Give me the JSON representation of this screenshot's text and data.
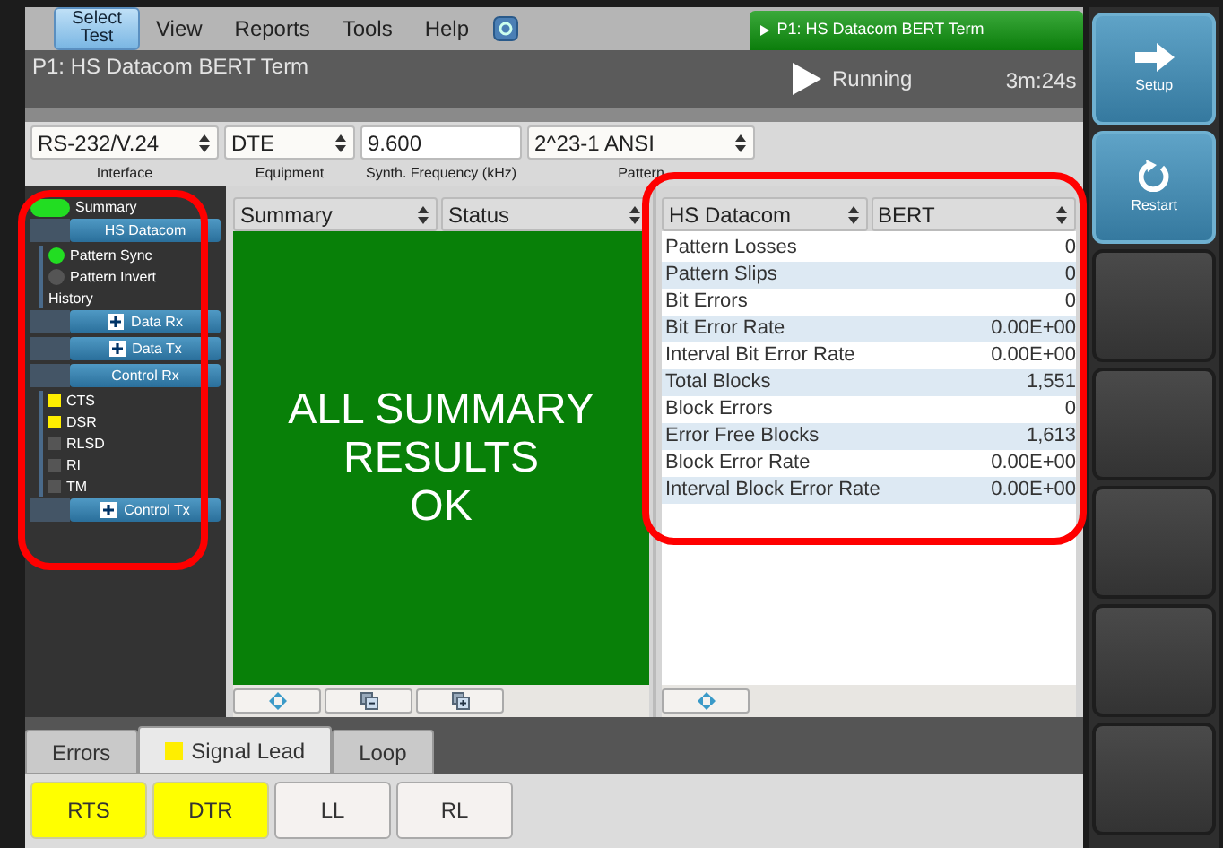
{
  "menu": {
    "select_test": "Select\nTest",
    "items": [
      "View",
      "Reports",
      "Tools",
      "Help"
    ]
  },
  "port_tab": {
    "label": "P1: HS Datacom BERT Term",
    "selected": true
  },
  "title": "P1: HS Datacom BERT Term",
  "status": "Running",
  "elapsed": "3m:24s",
  "config": [
    {
      "kind": "select",
      "value": "RS-232/V.24",
      "label": "Interface"
    },
    {
      "kind": "select",
      "value": "DTE",
      "label": "Equipment"
    },
    {
      "kind": "input",
      "value": "9.600",
      "label": "Synth. Frequency (kHz)"
    },
    {
      "kind": "select",
      "value": "2^23-1 ANSI",
      "label": "Pattern"
    }
  ],
  "sidebar": {
    "highlighted": true,
    "items": [
      {
        "kind": "pill",
        "label": "Summary",
        "color": "#22dd22"
      },
      {
        "kind": "section",
        "label": "HS Datacom",
        "expandable": false,
        "children": [
          {
            "kind": "led",
            "label": "Pattern Sync",
            "color": "#22dd22"
          },
          {
            "kind": "led",
            "label": "Pattern Invert",
            "color": "#555555"
          },
          {
            "kind": "text",
            "label": "History"
          }
        ]
      },
      {
        "kind": "section",
        "label": "Data Rx",
        "expandable": true
      },
      {
        "kind": "section",
        "label": "Data Tx",
        "expandable": true
      },
      {
        "kind": "section",
        "label": "Control Rx",
        "expandable": false,
        "children": [
          {
            "kind": "square",
            "label": "CTS",
            "color": "#ffee00"
          },
          {
            "kind": "square",
            "label": "DSR",
            "color": "#ffee00"
          },
          {
            "kind": "square",
            "label": "RLSD",
            "color": "#555555"
          },
          {
            "kind": "square",
            "label": "RI",
            "color": "#555555"
          },
          {
            "kind": "square",
            "label": "TM",
            "color": "#555555"
          }
        ]
      },
      {
        "kind": "section",
        "label": "Control Tx",
        "expandable": true
      }
    ]
  },
  "summary_panel": {
    "selects": [
      "Summary",
      "Status"
    ],
    "message": [
      "ALL SUMMARY",
      "RESULTS",
      "OK"
    ],
    "tools": [
      {
        "kind": "move"
      },
      {
        "kind": "collapse"
      },
      {
        "kind": "expand"
      }
    ]
  },
  "results_panel": {
    "highlighted": true,
    "selects": [
      "HS Datacom",
      "BERT"
    ],
    "rows": [
      {
        "label": "Pattern Losses",
        "value": "0"
      },
      {
        "label": "Pattern Slips",
        "value": "0"
      },
      {
        "label": "Bit Errors",
        "value": "0"
      },
      {
        "label": "Bit Error Rate",
        "value": "0.00E+00"
      },
      {
        "label": "Interval Bit Error Rate",
        "value": "0.00E+00"
      },
      {
        "label": "Total Blocks",
        "value": "1,551"
      },
      {
        "label": "Block Errors",
        "value": "0"
      },
      {
        "label": "Error Free Blocks",
        "value": "1,613"
      },
      {
        "label": "Block Error Rate",
        "value": "0.00E+00"
      },
      {
        "label": "Interval Block Error Rate",
        "value": "0.00E+00"
      }
    ],
    "tools": [
      {
        "kind": "move"
      }
    ]
  },
  "bottom_tabs": [
    {
      "label": "Errors",
      "selected": false
    },
    {
      "label": "Signal Lead",
      "selected": true,
      "color": "#ffee00"
    },
    {
      "label": "Loop",
      "selected": false
    }
  ],
  "lead_buttons": [
    {
      "label": "RTS",
      "on": true
    },
    {
      "label": "DTR",
      "on": true
    },
    {
      "label": "LL",
      "on": false
    },
    {
      "label": "RL",
      "on": false
    }
  ],
  "side_buttons": [
    {
      "kind": "setup",
      "label": "Setup"
    },
    {
      "kind": "restart",
      "label": "Restart"
    },
    {
      "kind": "blank"
    },
    {
      "kind": "blank"
    },
    {
      "kind": "blank"
    },
    {
      "kind": "blank"
    },
    {
      "kind": "blank"
    }
  ]
}
